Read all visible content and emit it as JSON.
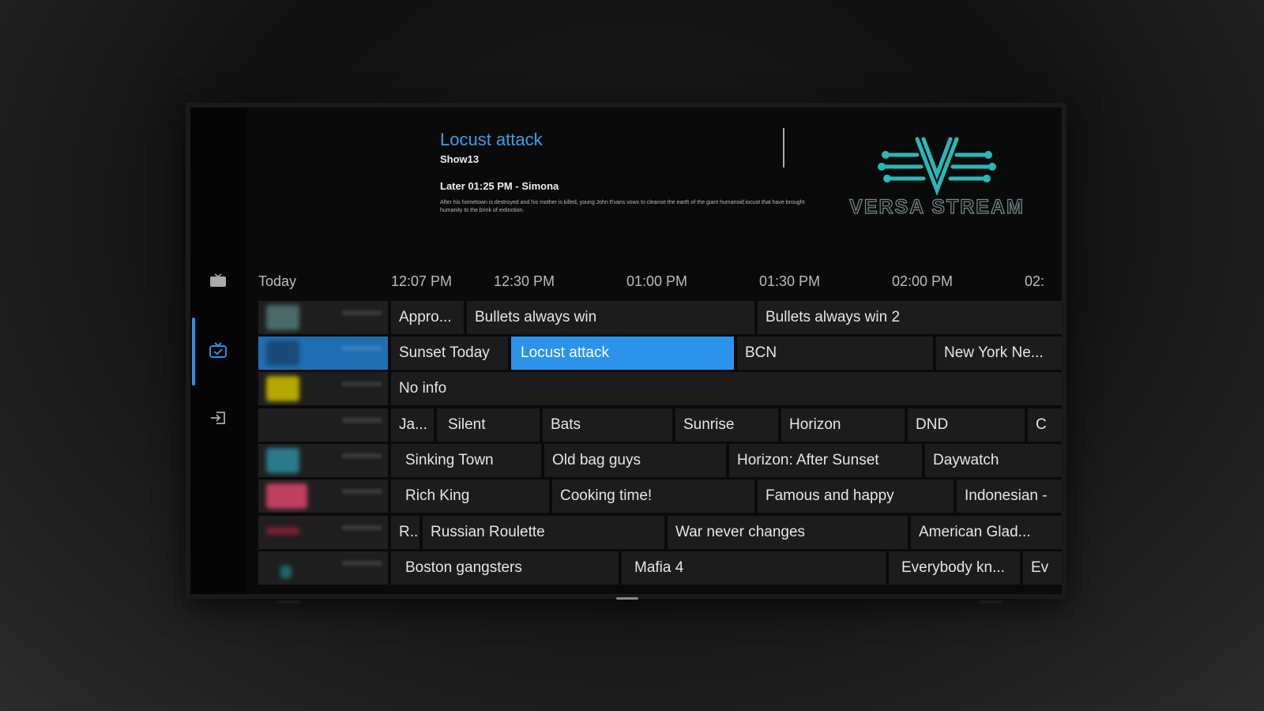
{
  "info": {
    "title": "Locust attack",
    "show": "Show13",
    "later": "Later 01:25 PM - Simona",
    "description": "After his hometown is destroyed and his mother is killed, young John Evans vows to cleanse the earth of the giant humanoid locust that have brought humanity to the brink of extinction."
  },
  "logo": {
    "text": "VERSA STREAM",
    "color": "#2ab7b7"
  },
  "sidebar": {
    "icons": [
      "tv-icon",
      "guide-icon",
      "logout-icon"
    ]
  },
  "timeline": {
    "day": "Today",
    "times": [
      "12:07 PM",
      "12:30 PM",
      "01:00 PM",
      "01:30 PM",
      "02:00 PM",
      "02:"
    ]
  },
  "channels": [
    {
      "logo_color": "#4a6a6a",
      "programs": [
        "Appro...",
        "Bullets always win",
        "Bullets always win 2"
      ]
    },
    {
      "logo_color": "#1a4a7a",
      "active": true,
      "programs": [
        "Sunset Today",
        "Locust attack",
        "BCN",
        "New York Ne..."
      ]
    },
    {
      "logo_color": "#b7a800",
      "programs": [
        "No info"
      ]
    },
    {
      "logo_color": "#1f1f1f",
      "programs": [
        "Ja...",
        "Silent",
        "Bats",
        "Sunrise",
        "Horizon",
        "DND",
        "C"
      ]
    },
    {
      "logo_color": "#2a7a8a",
      "programs": [
        "Sinking Town",
        "Old bag guys",
        "Horizon: After Sunset",
        "Daywatch"
      ]
    },
    {
      "logo_color": "#c04060",
      "programs": [
        "Rich King",
        "Cooking time!",
        "Famous and happy",
        "Indonesian -"
      ]
    },
    {
      "logo_color": "#7a2030",
      "programs": [
        "R...",
        "Russian Roulette",
        "War never changes",
        "American Glad..."
      ]
    },
    {
      "logo_color": "#1a6a6a",
      "programs": [
        "Boston gangsters",
        "Mafia 4",
        "Everybody kn...",
        "Ev"
      ]
    }
  ]
}
